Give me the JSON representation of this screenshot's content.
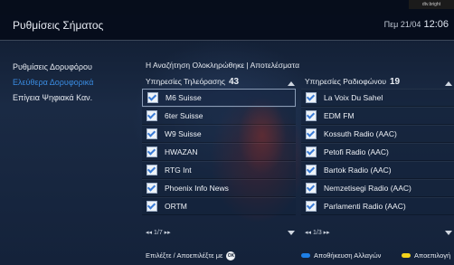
{
  "header": {
    "title": "Ρυθμίσεις Σήματος",
    "clock_day": "Πεμ 21/04",
    "clock_time": "12:06",
    "corner_label": "dtv.bright"
  },
  "menu": [
    {
      "label": "Ρυθμίσεις Δορυφόρου",
      "active": false
    },
    {
      "label": "Ελεύθερα Δορυφορικά",
      "active": true
    },
    {
      "label": "Επίγεια Ψηφιακά Καν.",
      "active": false
    }
  ],
  "status": "Η Αναζήτηση Ολοκληρώθηκε | Αποτελέσματα",
  "tv": {
    "label": "Υπηρεσίες Τηλεόρασης",
    "count": "43",
    "items": [
      "M6 Suisse",
      "6ter Suisse",
      "W9 Suisse",
      "HWAZAN",
      "RTG Int",
      "Phoenix Info News",
      "ORTM"
    ],
    "page": "1/7"
  },
  "radio": {
    "label": "Υπηρεσίες Ραδιοφώνου",
    "count": "19",
    "items": [
      "La Voix Du Sahel",
      "EDM FM",
      "Kossuth Radio (AAC)",
      "Petofi Radio (AAC)",
      "Bartok Radio (AAC)",
      "Nemzetisegi Radio (AAC)",
      "Parlamenti Radio (AAC)"
    ],
    "page": "1/3"
  },
  "footer": {
    "hint": "Επιλέξτε / Αποεπιλέξτε με",
    "ok": "OK",
    "save_label": "Αποθήκευση Αλλαγών",
    "cancel_label": "Αποεπιλογή",
    "blue": "#1e7fe6",
    "yellow": "#f2d21b"
  },
  "pager_prev": "◂◂",
  "pager_next": "▸▸"
}
